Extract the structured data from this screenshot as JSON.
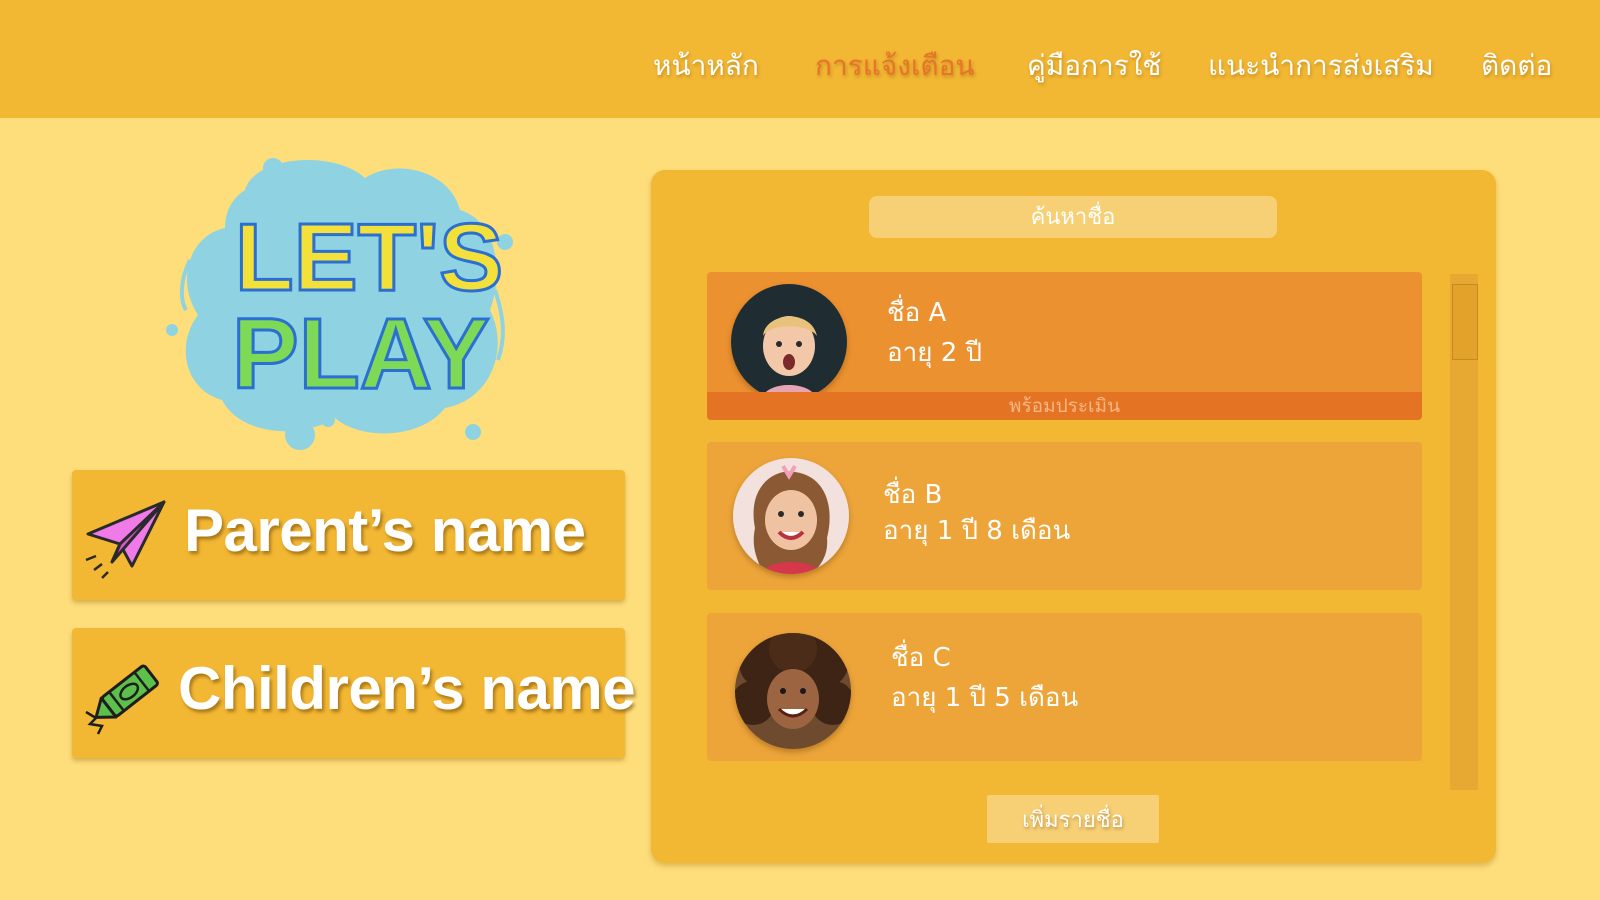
{
  "nav": {
    "items": [
      {
        "label": "หน้าหลัก"
      },
      {
        "label": "การแจ้งเตือน",
        "active": true
      },
      {
        "label": "คู่มือการใช้"
      },
      {
        "label": "แนะนำการส่งเสริม"
      },
      {
        "label": "ติดต่อ"
      }
    ]
  },
  "logo": {
    "line1": "LET'S",
    "line2": "PLAY"
  },
  "cards": {
    "parent": {
      "label": "Parent’s name",
      "icon": "paper-plane-icon"
    },
    "children": {
      "label": "Children’s name",
      "icon": "crayon-icon"
    }
  },
  "panel": {
    "search_placeholder": "ค้นหาชื่อ",
    "children": [
      {
        "name": "ชื่อ A",
        "age": "อายุ 2 ปี",
        "status": "พร้อมประเมิน",
        "selected": true
      },
      {
        "name": "ชื่อ B",
        "age": "อายุ 1 ปี 8 เดือน"
      },
      {
        "name": "ชื่อ C",
        "age": "อายุ 1 ปี 5 เดือน"
      }
    ],
    "add_button": "เพิ่มรายชื่อ"
  },
  "colors": {
    "background": "#FEDE7A",
    "header": "#F2B733",
    "active_nav": "#E8742A",
    "card_selected": "#EC9130",
    "card": "#EDA53A",
    "status_strip": "#E57324"
  }
}
